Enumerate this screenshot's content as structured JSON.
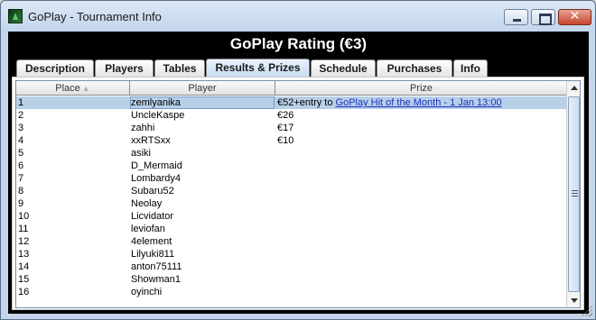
{
  "window": {
    "title": "GoPlay - Tournament Info",
    "app_icon": "goplay-logo-icon",
    "controls": {
      "minimize": "minimize-icon",
      "maximize": "maximize-icon",
      "close_label": "✕"
    }
  },
  "header": {
    "title": "GoPlay Rating (€3)"
  },
  "tabs": [
    {
      "label": "Description",
      "active": false
    },
    {
      "label": "Players",
      "active": false
    },
    {
      "label": "Tables",
      "active": false
    },
    {
      "label": "Results & Prizes",
      "active": true
    },
    {
      "label": "Schedule",
      "active": false
    },
    {
      "label": "Purchases",
      "active": false
    },
    {
      "label": "Info",
      "active": false
    }
  ],
  "table": {
    "columns": {
      "place": "Place",
      "player": "Player",
      "prize": "Prize"
    },
    "sort_indicator": "▲",
    "rows": [
      {
        "place": "1",
        "player": "zemlyanika",
        "prize": "€52+entry to ",
        "prize_link": "GoPlay Hit of the Month - 1 Jan 13:00",
        "selected": true
      },
      {
        "place": "2",
        "player": "UncleKaspe",
        "prize": "€26"
      },
      {
        "place": "3",
        "player": "zahhi",
        "prize": "€17"
      },
      {
        "place": "4",
        "player": "xxRTSxx",
        "prize": "€10"
      },
      {
        "place": "5",
        "player": "asiki",
        "prize": ""
      },
      {
        "place": "6",
        "player": "D_Mermaid",
        "prize": ""
      },
      {
        "place": "7",
        "player": "Lombardy4",
        "prize": ""
      },
      {
        "place": "8",
        "player": "Subaru52",
        "prize": ""
      },
      {
        "place": "9",
        "player": "Neolay",
        "prize": ""
      },
      {
        "place": "10",
        "player": "Licvidator",
        "prize": ""
      },
      {
        "place": "11",
        "player": "leviofan",
        "prize": ""
      },
      {
        "place": "12",
        "player": "4element",
        "prize": ""
      },
      {
        "place": "13",
        "player": "Lilyuki811",
        "prize": ""
      },
      {
        "place": "14",
        "player": "anton75111",
        "prize": ""
      },
      {
        "place": "15",
        "player": "Showman1",
        "prize": ""
      },
      {
        "place": "16",
        "player": "oyinchi",
        "prize": ""
      }
    ]
  },
  "colors": {
    "header_background": "#000000",
    "selected_row": "#b8cfe8",
    "active_tab": "#c6dbf2",
    "link": "#1a33c4"
  }
}
